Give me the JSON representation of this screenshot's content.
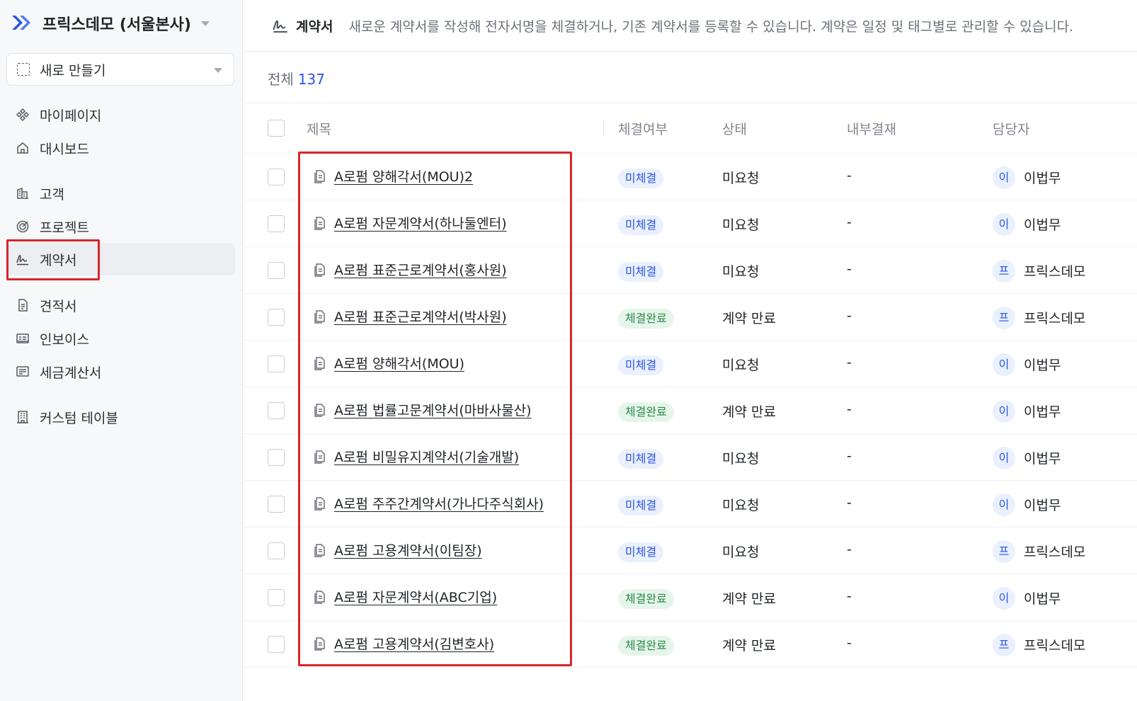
{
  "workspace": {
    "name": "프릭스데모 (서울본사)"
  },
  "sidebar": {
    "new_button": "새로 만들기",
    "items": [
      {
        "label": "마이페이지",
        "icon": "diamond-grid-icon"
      },
      {
        "label": "대시보드",
        "icon": "home-icon"
      },
      {
        "label": "고객",
        "icon": "building-icon"
      },
      {
        "label": "프로젝트",
        "icon": "target-icon"
      },
      {
        "label": "계약서",
        "icon": "signature-icon",
        "active": true
      },
      {
        "label": "견적서",
        "icon": "document-icon"
      },
      {
        "label": "인보이스",
        "icon": "invoice-icon"
      },
      {
        "label": "세금계산서",
        "icon": "receipt-icon"
      },
      {
        "label": "커스텀 테이블",
        "icon": "table-building-icon"
      }
    ]
  },
  "header": {
    "title": "계약서",
    "description": "새로운 계약서를 작성해 전자서명을 체결하거나, 기존 계약서를 등록할 수 있습니다. 계약은 일정 및 태그별로 관리할 수 있습니다."
  },
  "summary": {
    "label": "전체",
    "count": "137"
  },
  "table": {
    "columns": {
      "title": "제목",
      "signed": "체결여부",
      "status": "상태",
      "internal": "내부결재",
      "owner": "담당자"
    },
    "rows": [
      {
        "title": "A로펌 양해각서(MOU)2",
        "signed": "미체결",
        "signed_state": "pending",
        "status": "미요청",
        "internal": "-",
        "avatar": "이",
        "owner": "이법무"
      },
      {
        "title": "A로펌 자문계약서(하나둘엔터)",
        "signed": "미체결",
        "signed_state": "pending",
        "status": "미요청",
        "internal": "-",
        "avatar": "이",
        "owner": "이법무"
      },
      {
        "title": "A로펌 표준근로계약서(홍사원)",
        "signed": "미체결",
        "signed_state": "pending",
        "status": "미요청",
        "internal": "-",
        "avatar": "프",
        "owner": "프릭스데모"
      },
      {
        "title": "A로펌 표준근로계약서(박사원)",
        "signed": "체결완료",
        "signed_state": "done",
        "status": "계약 만료",
        "internal": "-",
        "avatar": "프",
        "owner": "프릭스데모"
      },
      {
        "title": "A로펌 양해각서(MOU)",
        "signed": "미체결",
        "signed_state": "pending",
        "status": "미요청",
        "internal": "-",
        "avatar": "이",
        "owner": "이법무"
      },
      {
        "title": "A로펌 법률고문계약서(마바사물산)",
        "signed": "체결완료",
        "signed_state": "done",
        "status": "계약 만료",
        "internal": "-",
        "avatar": "이",
        "owner": "이법무"
      },
      {
        "title": "A로펌 비밀유지계약서(기술개발)",
        "signed": "미체결",
        "signed_state": "pending",
        "status": "미요청",
        "internal": "-",
        "avatar": "이",
        "owner": "이법무"
      },
      {
        "title": "A로펌 주주간계약서(가나다주식회사)",
        "signed": "미체결",
        "signed_state": "pending",
        "status": "미요청",
        "internal": "-",
        "avatar": "이",
        "owner": "이법무"
      },
      {
        "title": "A로펌 고용계약서(이팀장)",
        "signed": "미체결",
        "signed_state": "pending",
        "status": "미요청",
        "internal": "-",
        "avatar": "프",
        "owner": "프릭스데모"
      },
      {
        "title": "A로펌 자문계약서(ABC기업)",
        "signed": "체결완료",
        "signed_state": "done",
        "status": "계약 만료",
        "internal": "-",
        "avatar": "이",
        "owner": "이법무"
      },
      {
        "title": "A로펌 고용계약서(김변호사)",
        "signed": "체결완료",
        "signed_state": "done",
        "status": "계약 만료",
        "internal": "-",
        "avatar": "프",
        "owner": "프릭스데모"
      }
    ]
  },
  "colors": {
    "accent": "#2a55e6",
    "highlight": "#d9252a",
    "done": "#2b8a4a"
  }
}
